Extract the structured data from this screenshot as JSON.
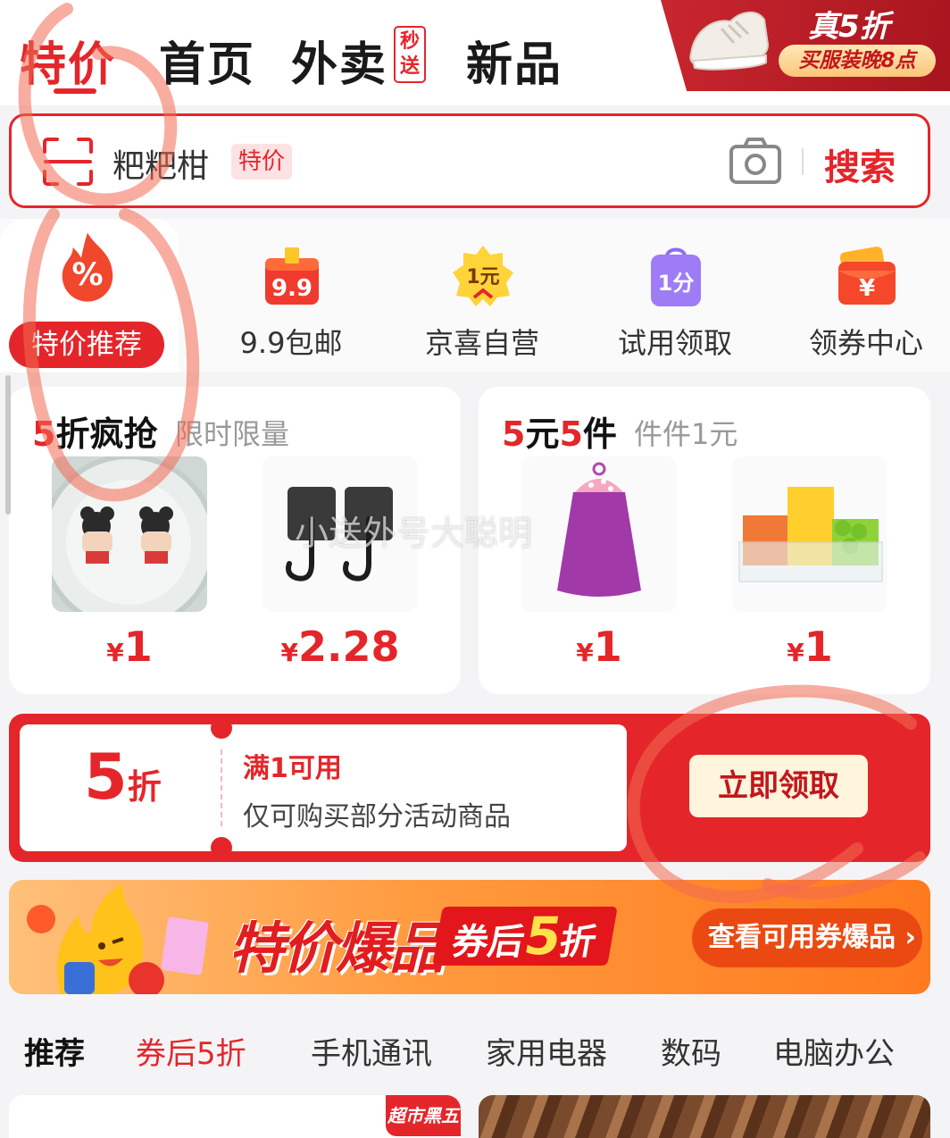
{
  "top_tabs": [
    {
      "label": "特价"
    },
    {
      "label": "首页"
    },
    {
      "label": "外卖",
      "badge": "秒送"
    },
    {
      "label": "新品"
    }
  ],
  "promo_corner": {
    "big": "真5折",
    "pill": "买服装晚8点"
  },
  "search": {
    "text": "粑粑柑",
    "tag": "特价",
    "button": "搜索"
  },
  "icon_nav": [
    {
      "label": "特价推荐",
      "icon": "percent-flame-icon",
      "icon_text": "%"
    },
    {
      "label": "9.9包邮",
      "icon": "gift-box-icon",
      "icon_text": "9.9"
    },
    {
      "label": "京喜自营",
      "icon": "yuan-badge-icon",
      "icon_text": "1元"
    },
    {
      "label": "试用领取",
      "icon": "shopping-bag-icon",
      "icon_text": "1分"
    },
    {
      "label": "领券中心",
      "icon": "red-envelope-icon",
      "icon_text": "¥"
    }
  ],
  "deals": [
    {
      "title_red": "5",
      "title": "折疯抢",
      "subtitle": "限时限量",
      "items": [
        {
          "name": "cartoon-plate",
          "price": "1"
        },
        {
          "name": "wall-hooks",
          "price": "2.28"
        }
      ]
    },
    {
      "title_red": "5",
      "title_mid": "元",
      "title_red2": "5",
      "title": "件",
      "subtitle": "件件1元",
      "items": [
        {
          "name": "hand-towel",
          "price": "1"
        },
        {
          "name": "vegetable-box",
          "price": "1"
        }
      ]
    }
  ],
  "currency": "¥",
  "coupon": {
    "amount": "5",
    "unit": "折",
    "condition": "满1可用",
    "desc": "仅可购买部分活动商品",
    "button": "立即领取"
  },
  "banner": {
    "title": "特价爆品",
    "sub_prefix": "券后",
    "sub_num": "5",
    "sub_suffix": "折",
    "cta": "查看可用券爆品 ›"
  },
  "category_tabs": [
    "推荐",
    "券后5折",
    "手机通讯",
    "家用电器",
    "数码",
    "电脑办公"
  ],
  "feed": [
    {
      "tag": "超市黑五"
    }
  ],
  "watermark": "小送外号大聪明",
  "colors": {
    "accent": "#e4262b",
    "banner": "#ff8a2e",
    "coupon_btn": "#fff4dc"
  }
}
